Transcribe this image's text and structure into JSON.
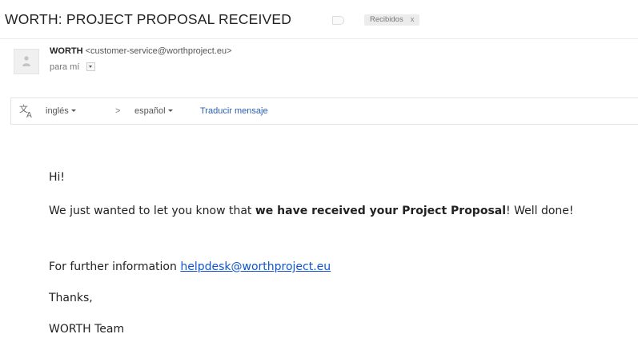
{
  "subject": "WORTH: PROJECT PROPOSAL RECEIVED",
  "label_chip": {
    "label": "Recibidos",
    "remove": "x"
  },
  "sender": {
    "name": "WORTH",
    "email": "<customer-service@worthproject.eu>",
    "recipient": "para mí"
  },
  "translate_bar": {
    "source_language": "inglés",
    "arrow": ">",
    "target_language": "español",
    "translate_link": "Traducir mensaje"
  },
  "message": {
    "greeting": "Hi!",
    "line1_before": "We just wanted to let you know that ",
    "line1_bold": "we have received your Project Proposal",
    "line1_after": "! Well done!",
    "info_prefix": "For further information ",
    "helpdesk_email": "helpdesk@worthproject.eu",
    "thanks": "Thanks,",
    "signature": "WORTH Team"
  },
  "colors": {
    "link": "#1155cc",
    "translate_link": "#2b5db3"
  }
}
